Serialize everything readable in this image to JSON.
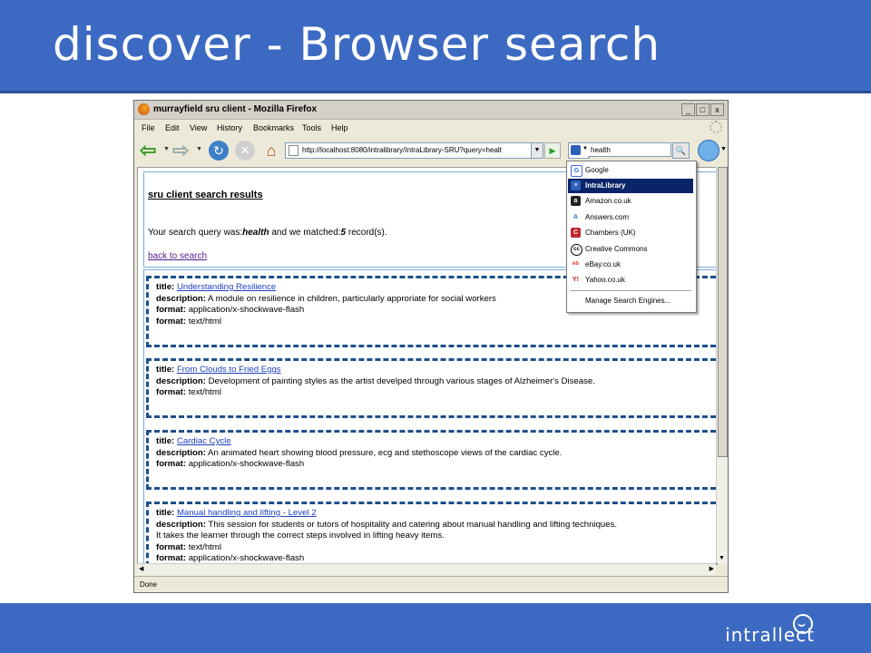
{
  "slide": {
    "title": "discover - Browser search",
    "logo": "intrallect"
  },
  "window": {
    "title": "murrayfield sru client - Mozilla Firefox",
    "controls": [
      "_",
      "□",
      "x"
    ],
    "menus": [
      "File",
      "Edit",
      "View",
      "History",
      "Bookmarks",
      "Tools",
      "Help"
    ],
    "url": "http://localhost:8080/intralibrary/IntraLibrary-SRU?query=healt",
    "search_value": "health",
    "status": "Done"
  },
  "search_engines": {
    "items": [
      {
        "label": "Google",
        "icon": "google-icon",
        "icon_glyph": "G",
        "color": "#3a6bd6",
        "selected": false
      },
      {
        "label": "IntraLibrary",
        "icon": "intralibrary-icon",
        "icon_glyph": "≡",
        "color": "#2d5fb8",
        "selected": true
      },
      {
        "label": "Amazon.co.uk",
        "icon": "amazon-icon",
        "icon_glyph": "a",
        "color": "#222222",
        "selected": false
      },
      {
        "label": "Answers.com",
        "icon": "answers-icon",
        "icon_glyph": "A",
        "color": "#3a6bd6",
        "selected": false
      },
      {
        "label": "Chambers (UK)",
        "icon": "chambers-icon",
        "icon_glyph": "C",
        "color": "#c0262d",
        "selected": false
      },
      {
        "label": "Creative Commons",
        "icon": "creative-commons-icon",
        "icon_glyph": "cc",
        "color": "#000000",
        "selected": false
      },
      {
        "label": "eBay.co.uk",
        "icon": "ebay-icon",
        "icon_glyph": "eb",
        "color": "#e53238",
        "selected": false
      },
      {
        "label": "Yahoo.co.uk",
        "icon": "yahoo-icon",
        "icon_glyph": "Y!",
        "color": "#c0191e",
        "selected": false
      }
    ],
    "manage": "Manage Search Engines..."
  },
  "page": {
    "heading": "sru client search results",
    "query_prefix": "Your search query was:",
    "query": "health",
    "query_mid": " and we matched:",
    "count": "5",
    "query_suffix": " record(s).",
    "back_link": "back to search",
    "field_labels": {
      "title": "title:",
      "description": "description:",
      "format": "format:"
    },
    "records": [
      {
        "title": "Understanding Resilience",
        "description": "A module on resilience in children, particularly approriate for social workers",
        "formats": [
          "application/x-shockwave-flash",
          "text/html"
        ]
      },
      {
        "title": "From Clouds to Fried Eggs",
        "description": "Development of painting styles as the artist develped through various stages of Alzheimer's Disease.",
        "formats": [
          "text/html"
        ]
      },
      {
        "title": "Cardiac Cycle",
        "description": "An animated heart showing blood pressure, ecg and stethoscope views of the cardiac cycle.",
        "formats": [
          "application/x-shockwave-flash"
        ]
      },
      {
        "title": "Manual handling and lifting - Level 2",
        "description": "This session for students or tutors of hospitality and catering about manual handling and lifting techniques.",
        "description2": "It takes the learner through the correct steps involved in lifting heavy items.",
        "formats": [
          "text/html",
          "application/x-shockwave-flash"
        ]
      }
    ]
  }
}
